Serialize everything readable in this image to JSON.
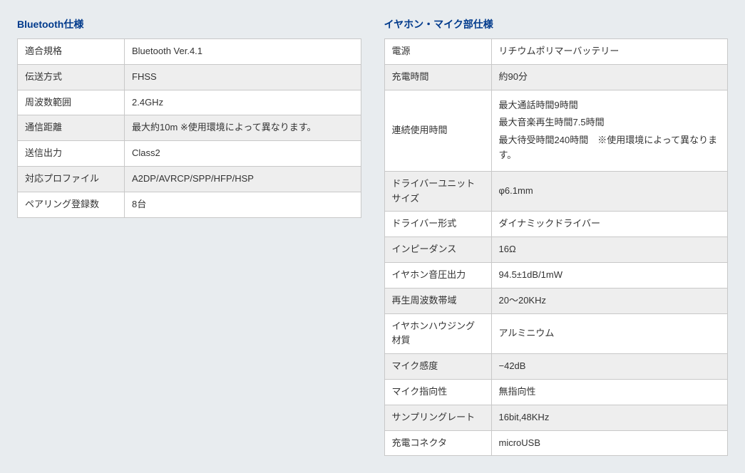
{
  "left": {
    "title": "Bluetooth仕様",
    "rows": [
      {
        "label": "適合規格",
        "value": "Bluetooth Ver.4.1"
      },
      {
        "label": "伝送方式",
        "value": "FHSS"
      },
      {
        "label": "周波数範囲",
        "value": "2.4GHz"
      },
      {
        "label": "通信距離",
        "value": "最大約10m ※使用環境によって異なります。"
      },
      {
        "label": "送信出力",
        "value": "Class2"
      },
      {
        "label": "対応プロファイル",
        "value": "A2DP/AVRCP/SPP/HFP/HSP"
      },
      {
        "label": "ペアリング登録数",
        "value": "8台"
      }
    ]
  },
  "right": {
    "title": "イヤホン・マイク部仕様",
    "rows": [
      {
        "label": "電源",
        "value": "リチウムポリマーバッテリー"
      },
      {
        "label": "充電時間",
        "value": "約90分"
      },
      {
        "label": "連続使用時間",
        "multiline": [
          "最大通話時間9時間",
          "最大音楽再生時間7.5時間",
          "最大待受時間240時間　※使用環境によって異なります。"
        ]
      },
      {
        "label": "ドライバーユニットサイズ",
        "value": "φ6.1mm"
      },
      {
        "label": "ドライバー形式",
        "value": "ダイナミックドライバー"
      },
      {
        "label": "インピーダンス",
        "value": "16Ω"
      },
      {
        "label": "イヤホン音圧出力",
        "value": "94.5±1dB/1mW"
      },
      {
        "label": "再生周波数帯域",
        "value": "20～20KHz"
      },
      {
        "label": "イヤホンハウジング材質",
        "value": "アルミニウム"
      },
      {
        "label": "マイク感度",
        "value": "−42dB"
      },
      {
        "label": "マイク指向性",
        "value": "無指向性"
      },
      {
        "label": "サンプリングレート",
        "value": "16bit,48KHz"
      },
      {
        "label": "充電コネクタ",
        "value": "microUSB"
      }
    ]
  }
}
